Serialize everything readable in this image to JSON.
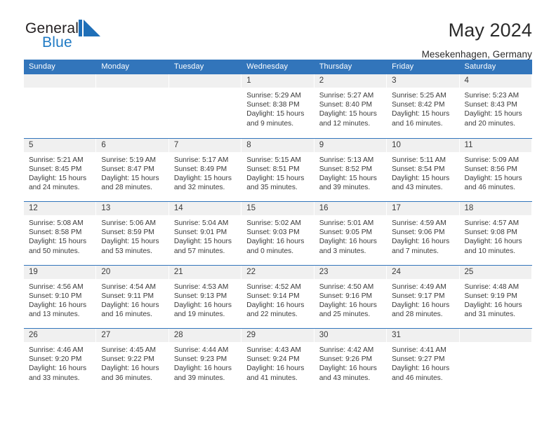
{
  "brand": {
    "name_top": "General",
    "name_bottom": "Blue",
    "accent_color": "#1f7ac4",
    "text_color": "#231f20",
    "mark": "triangle-logo"
  },
  "header": {
    "title": "May 2024",
    "subtitle": "Mesekenhagen, Germany"
  },
  "theme": {
    "header_bg": "#3275bb",
    "header_text": "#ffffff",
    "datebar_bg": "#f0f0f0",
    "cell_text": "#3a3a3a",
    "week_divider": "#3275bb"
  },
  "weekdays": [
    "Sunday",
    "Monday",
    "Tuesday",
    "Wednesday",
    "Thursday",
    "Friday",
    "Saturday"
  ],
  "weeks": [
    [
      {
        "day": "",
        "sunrise": "",
        "sunset": "",
        "daylight1": "",
        "daylight2": ""
      },
      {
        "day": "",
        "sunrise": "",
        "sunset": "",
        "daylight1": "",
        "daylight2": ""
      },
      {
        "day": "",
        "sunrise": "",
        "sunset": "",
        "daylight1": "",
        "daylight2": ""
      },
      {
        "day": "1",
        "sunrise": "Sunrise: 5:29 AM",
        "sunset": "Sunset: 8:38 PM",
        "daylight1": "Daylight: 15 hours",
        "daylight2": "and 9 minutes."
      },
      {
        "day": "2",
        "sunrise": "Sunrise: 5:27 AM",
        "sunset": "Sunset: 8:40 PM",
        "daylight1": "Daylight: 15 hours",
        "daylight2": "and 12 minutes."
      },
      {
        "day": "3",
        "sunrise": "Sunrise: 5:25 AM",
        "sunset": "Sunset: 8:42 PM",
        "daylight1": "Daylight: 15 hours",
        "daylight2": "and 16 minutes."
      },
      {
        "day": "4",
        "sunrise": "Sunrise: 5:23 AM",
        "sunset": "Sunset: 8:43 PM",
        "daylight1": "Daylight: 15 hours",
        "daylight2": "and 20 minutes."
      }
    ],
    [
      {
        "day": "5",
        "sunrise": "Sunrise: 5:21 AM",
        "sunset": "Sunset: 8:45 PM",
        "daylight1": "Daylight: 15 hours",
        "daylight2": "and 24 minutes."
      },
      {
        "day": "6",
        "sunrise": "Sunrise: 5:19 AM",
        "sunset": "Sunset: 8:47 PM",
        "daylight1": "Daylight: 15 hours",
        "daylight2": "and 28 minutes."
      },
      {
        "day": "7",
        "sunrise": "Sunrise: 5:17 AM",
        "sunset": "Sunset: 8:49 PM",
        "daylight1": "Daylight: 15 hours",
        "daylight2": "and 32 minutes."
      },
      {
        "day": "8",
        "sunrise": "Sunrise: 5:15 AM",
        "sunset": "Sunset: 8:51 PM",
        "daylight1": "Daylight: 15 hours",
        "daylight2": "and 35 minutes."
      },
      {
        "day": "9",
        "sunrise": "Sunrise: 5:13 AM",
        "sunset": "Sunset: 8:52 PM",
        "daylight1": "Daylight: 15 hours",
        "daylight2": "and 39 minutes."
      },
      {
        "day": "10",
        "sunrise": "Sunrise: 5:11 AM",
        "sunset": "Sunset: 8:54 PM",
        "daylight1": "Daylight: 15 hours",
        "daylight2": "and 43 minutes."
      },
      {
        "day": "11",
        "sunrise": "Sunrise: 5:09 AM",
        "sunset": "Sunset: 8:56 PM",
        "daylight1": "Daylight: 15 hours",
        "daylight2": "and 46 minutes."
      }
    ],
    [
      {
        "day": "12",
        "sunrise": "Sunrise: 5:08 AM",
        "sunset": "Sunset: 8:58 PM",
        "daylight1": "Daylight: 15 hours",
        "daylight2": "and 50 minutes."
      },
      {
        "day": "13",
        "sunrise": "Sunrise: 5:06 AM",
        "sunset": "Sunset: 8:59 PM",
        "daylight1": "Daylight: 15 hours",
        "daylight2": "and 53 minutes."
      },
      {
        "day": "14",
        "sunrise": "Sunrise: 5:04 AM",
        "sunset": "Sunset: 9:01 PM",
        "daylight1": "Daylight: 15 hours",
        "daylight2": "and 57 minutes."
      },
      {
        "day": "15",
        "sunrise": "Sunrise: 5:02 AM",
        "sunset": "Sunset: 9:03 PM",
        "daylight1": "Daylight: 16 hours",
        "daylight2": "and 0 minutes."
      },
      {
        "day": "16",
        "sunrise": "Sunrise: 5:01 AM",
        "sunset": "Sunset: 9:05 PM",
        "daylight1": "Daylight: 16 hours",
        "daylight2": "and 3 minutes."
      },
      {
        "day": "17",
        "sunrise": "Sunrise: 4:59 AM",
        "sunset": "Sunset: 9:06 PM",
        "daylight1": "Daylight: 16 hours",
        "daylight2": "and 7 minutes."
      },
      {
        "day": "18",
        "sunrise": "Sunrise: 4:57 AM",
        "sunset": "Sunset: 9:08 PM",
        "daylight1": "Daylight: 16 hours",
        "daylight2": "and 10 minutes."
      }
    ],
    [
      {
        "day": "19",
        "sunrise": "Sunrise: 4:56 AM",
        "sunset": "Sunset: 9:10 PM",
        "daylight1": "Daylight: 16 hours",
        "daylight2": "and 13 minutes."
      },
      {
        "day": "20",
        "sunrise": "Sunrise: 4:54 AM",
        "sunset": "Sunset: 9:11 PM",
        "daylight1": "Daylight: 16 hours",
        "daylight2": "and 16 minutes."
      },
      {
        "day": "21",
        "sunrise": "Sunrise: 4:53 AM",
        "sunset": "Sunset: 9:13 PM",
        "daylight1": "Daylight: 16 hours",
        "daylight2": "and 19 minutes."
      },
      {
        "day": "22",
        "sunrise": "Sunrise: 4:52 AM",
        "sunset": "Sunset: 9:14 PM",
        "daylight1": "Daylight: 16 hours",
        "daylight2": "and 22 minutes."
      },
      {
        "day": "23",
        "sunrise": "Sunrise: 4:50 AM",
        "sunset": "Sunset: 9:16 PM",
        "daylight1": "Daylight: 16 hours",
        "daylight2": "and 25 minutes."
      },
      {
        "day": "24",
        "sunrise": "Sunrise: 4:49 AM",
        "sunset": "Sunset: 9:17 PM",
        "daylight1": "Daylight: 16 hours",
        "daylight2": "and 28 minutes."
      },
      {
        "day": "25",
        "sunrise": "Sunrise: 4:48 AM",
        "sunset": "Sunset: 9:19 PM",
        "daylight1": "Daylight: 16 hours",
        "daylight2": "and 31 minutes."
      }
    ],
    [
      {
        "day": "26",
        "sunrise": "Sunrise: 4:46 AM",
        "sunset": "Sunset: 9:20 PM",
        "daylight1": "Daylight: 16 hours",
        "daylight2": "and 33 minutes."
      },
      {
        "day": "27",
        "sunrise": "Sunrise: 4:45 AM",
        "sunset": "Sunset: 9:22 PM",
        "daylight1": "Daylight: 16 hours",
        "daylight2": "and 36 minutes."
      },
      {
        "day": "28",
        "sunrise": "Sunrise: 4:44 AM",
        "sunset": "Sunset: 9:23 PM",
        "daylight1": "Daylight: 16 hours",
        "daylight2": "and 39 minutes."
      },
      {
        "day": "29",
        "sunrise": "Sunrise: 4:43 AM",
        "sunset": "Sunset: 9:24 PM",
        "daylight1": "Daylight: 16 hours",
        "daylight2": "and 41 minutes."
      },
      {
        "day": "30",
        "sunrise": "Sunrise: 4:42 AM",
        "sunset": "Sunset: 9:26 PM",
        "daylight1": "Daylight: 16 hours",
        "daylight2": "and 43 minutes."
      },
      {
        "day": "31",
        "sunrise": "Sunrise: 4:41 AM",
        "sunset": "Sunset: 9:27 PM",
        "daylight1": "Daylight: 16 hours",
        "daylight2": "and 46 minutes."
      },
      {
        "day": "",
        "sunrise": "",
        "sunset": "",
        "daylight1": "",
        "daylight2": ""
      }
    ]
  ]
}
